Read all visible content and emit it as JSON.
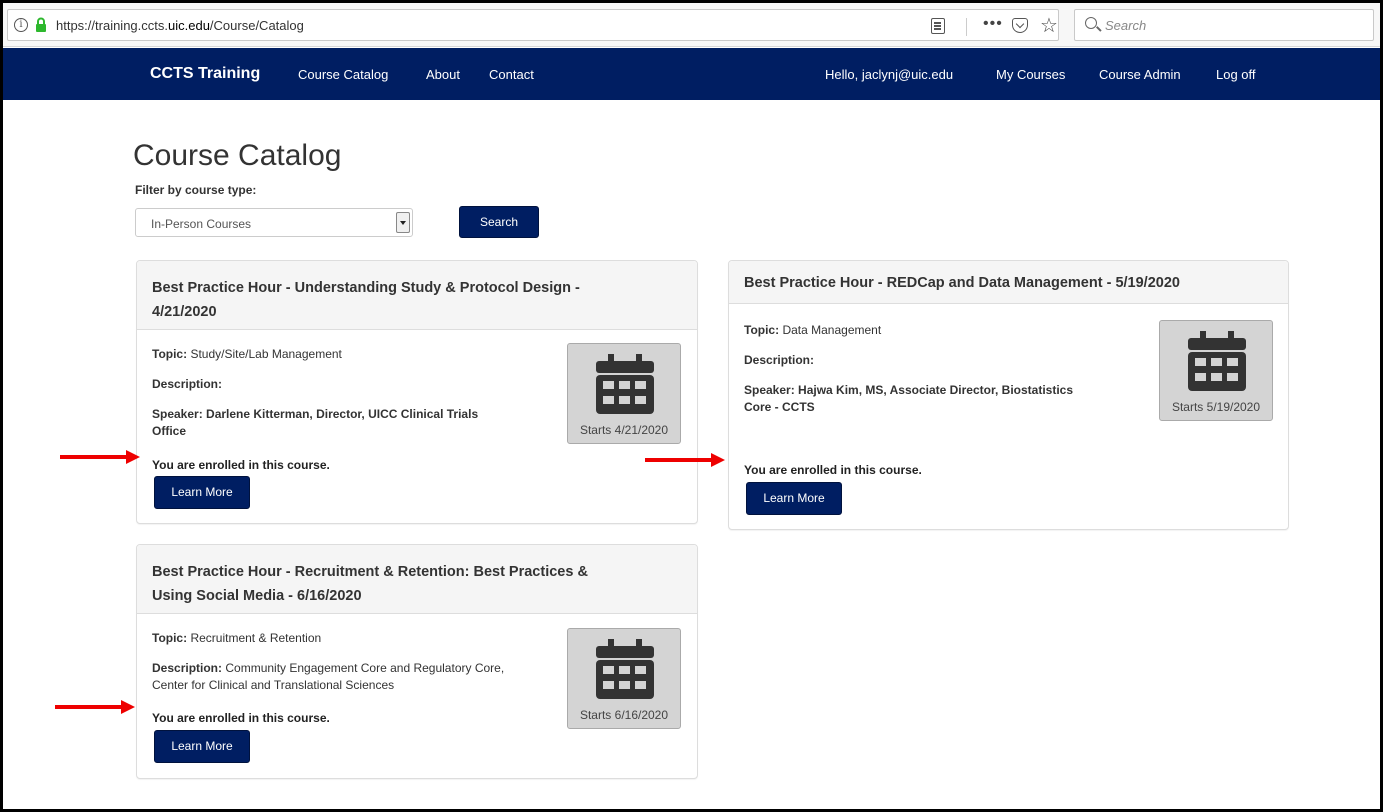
{
  "browser": {
    "url_prefix": "https://training.ccts.",
    "url_domain": "uic.edu",
    "url_suffix": "/Course/Catalog",
    "search_placeholder": "Search",
    "more_glyph": "•••",
    "star_glyph": "☆",
    "info_glyph": "i"
  },
  "nav": {
    "brand": "CCTS Training",
    "left": [
      "Course Catalog",
      "About",
      "Contact"
    ],
    "greeting": "Hello, jaclynj@uic.edu",
    "my_courses": "My Courses",
    "course_admin": "Course Admin",
    "log_off": "Log off"
  },
  "page": {
    "title": "Course Catalog",
    "filter_label": "Filter by course type:",
    "filter_value": "In-Person Courses",
    "search_button": "Search"
  },
  "courses": [
    {
      "title_line1": "Best Practice Hour - Understanding Study & Protocol Design -",
      "title_line2": "4/21/2020",
      "topic_label": "Topic:",
      "topic": "Study/Site/Lab Management",
      "description_label": "Description:",
      "description": "",
      "speaker_line1": "Speaker: Darlene Kitterman, Director, UICC Clinical Trials",
      "speaker_line2": "Office",
      "enrolled": "You are enrolled in this course.",
      "learn_more": "Learn More",
      "starts": "Starts 4/21/2020"
    },
    {
      "title_line1": "Best Practice Hour - REDCap and Data Management - 5/19/2020",
      "topic_label": "Topic:",
      "topic": "Data Management",
      "description_label": "Description:",
      "description": "",
      "speaker_line1": "Speaker: Hajwa Kim, MS, Associate Director, Biostatistics",
      "speaker_line2": "Core - CCTS",
      "enrolled": "You are enrolled in this course.",
      "learn_more": "Learn More",
      "starts": "Starts 5/19/2020"
    },
    {
      "title_line1": "Best Practice Hour - Recruitment & Retention: Best Practices &",
      "title_line2": "Using Social Media - 6/16/2020",
      "topic_label": "Topic:",
      "topic": "Recruitment & Retention",
      "description_label": "Description:",
      "description_line1": "Community Engagement Core and Regulatory Core,",
      "description_line2": "Center for Clinical and Translational Sciences",
      "enrolled": "You are enrolled in this course.",
      "learn_more": "Learn More",
      "starts": "Starts 6/16/2020"
    }
  ],
  "colors": {
    "nav_bg": "#001e62",
    "button_bg": "#001e62",
    "arrow": "#ee0000",
    "tile_bg": "#d4d4d4"
  }
}
